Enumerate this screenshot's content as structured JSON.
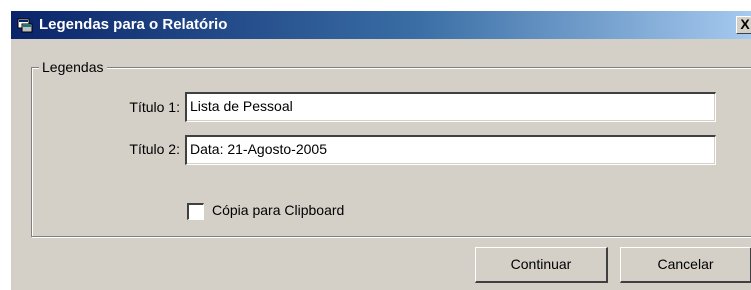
{
  "window": {
    "title": "Legendas para o Relatório",
    "icon": "app-icon",
    "close_label": "X"
  },
  "group": {
    "legend": "Legendas"
  },
  "fields": {
    "titulo1_label": "Título 1:",
    "titulo1_value": "Lista de Pessoal",
    "titulo2_label": "Título 2:",
    "titulo2_value": "Data: 21-Agosto-2005"
  },
  "options": {
    "clipboard_label": "Cópia para Clipboard",
    "clipboard_checked": false
  },
  "buttons": {
    "continue_label": "Continuar",
    "cancel_label": "Cancelar"
  }
}
